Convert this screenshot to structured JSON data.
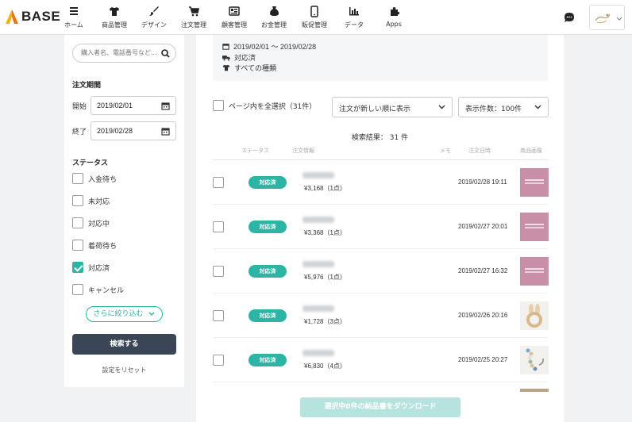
{
  "brand": {
    "name": "BASE"
  },
  "nav": [
    {
      "label": "ホーム",
      "icon": "home-icon"
    },
    {
      "label": "商品管理",
      "icon": "tshirt-icon"
    },
    {
      "label": "デザイン",
      "icon": "brush-icon"
    },
    {
      "label": "注文管理",
      "icon": "cart-icon"
    },
    {
      "label": "顧客管理",
      "icon": "customer-card-icon"
    },
    {
      "label": "お金管理",
      "icon": "money-bag-icon"
    },
    {
      "label": "販促管理",
      "icon": "smartphone-icon"
    },
    {
      "label": "データ",
      "icon": "bar-chart-icon"
    },
    {
      "label": "Apps",
      "icon": "puzzle-icon"
    }
  ],
  "sidebar": {
    "search_placeholder": "購入者名、電話番号など...",
    "period_title": "注文期間",
    "start_label": "開始",
    "start_value": "2019/02/01",
    "end_label": "終了",
    "end_value": "2019/02/28",
    "status_title": "ステータス",
    "statuses": [
      {
        "label": "入金待ち",
        "checked": false
      },
      {
        "label": "未対応",
        "checked": false
      },
      {
        "label": "対応中",
        "checked": false
      },
      {
        "label": "着荷待ち",
        "checked": false
      },
      {
        "label": "対応済",
        "checked": true
      },
      {
        "label": "キャンセル",
        "checked": false
      }
    ],
    "more_label": "さらに絞り込む",
    "search_button": "検索する",
    "reset_label": "設定をリセット"
  },
  "summary": {
    "period": "2019/02/01 〜 2019/02/28",
    "status": "対応済",
    "type": "すべての種類"
  },
  "controls": {
    "select_all_label": "ページ内を全選択（31件）",
    "sort_value": "注文が新しい順に表示",
    "per_page_value": "表示件数：100件"
  },
  "result_count": "検索結果： 31 件",
  "columns": {
    "status": "ステータス",
    "order_info": "注文情報",
    "memo": "メモ",
    "order_date": "注文日時",
    "product_image": "商品画像"
  },
  "orders": [
    {
      "status": "対応済",
      "price": "¥3,168（1点）",
      "date": "2019/02/28 19:11",
      "thumb": "pink"
    },
    {
      "status": "対応済",
      "price": "¥3,368（1点）",
      "date": "2019/02/27 20:01",
      "thumb": "pink"
    },
    {
      "status": "対応済",
      "price": "¥5,976（1点）",
      "date": "2019/02/27 16:32",
      "thumb": "pink"
    },
    {
      "status": "対応済",
      "price": "¥1,728（3点）",
      "date": "2019/02/26 20:16",
      "thumb": "bunny-ring"
    },
    {
      "status": "対応済",
      "price": "¥6,830（4点）",
      "date": "2019/02/25 20:27",
      "thumb": "bead-chain"
    }
  ],
  "download_button": "選択中0件の納品書をダウンロード",
  "colors": {
    "accent": "#2cb4a5",
    "dark_button": "#3a4556",
    "download_disabled": "#b6e3de",
    "thumb_pink": "#c98fa8"
  }
}
